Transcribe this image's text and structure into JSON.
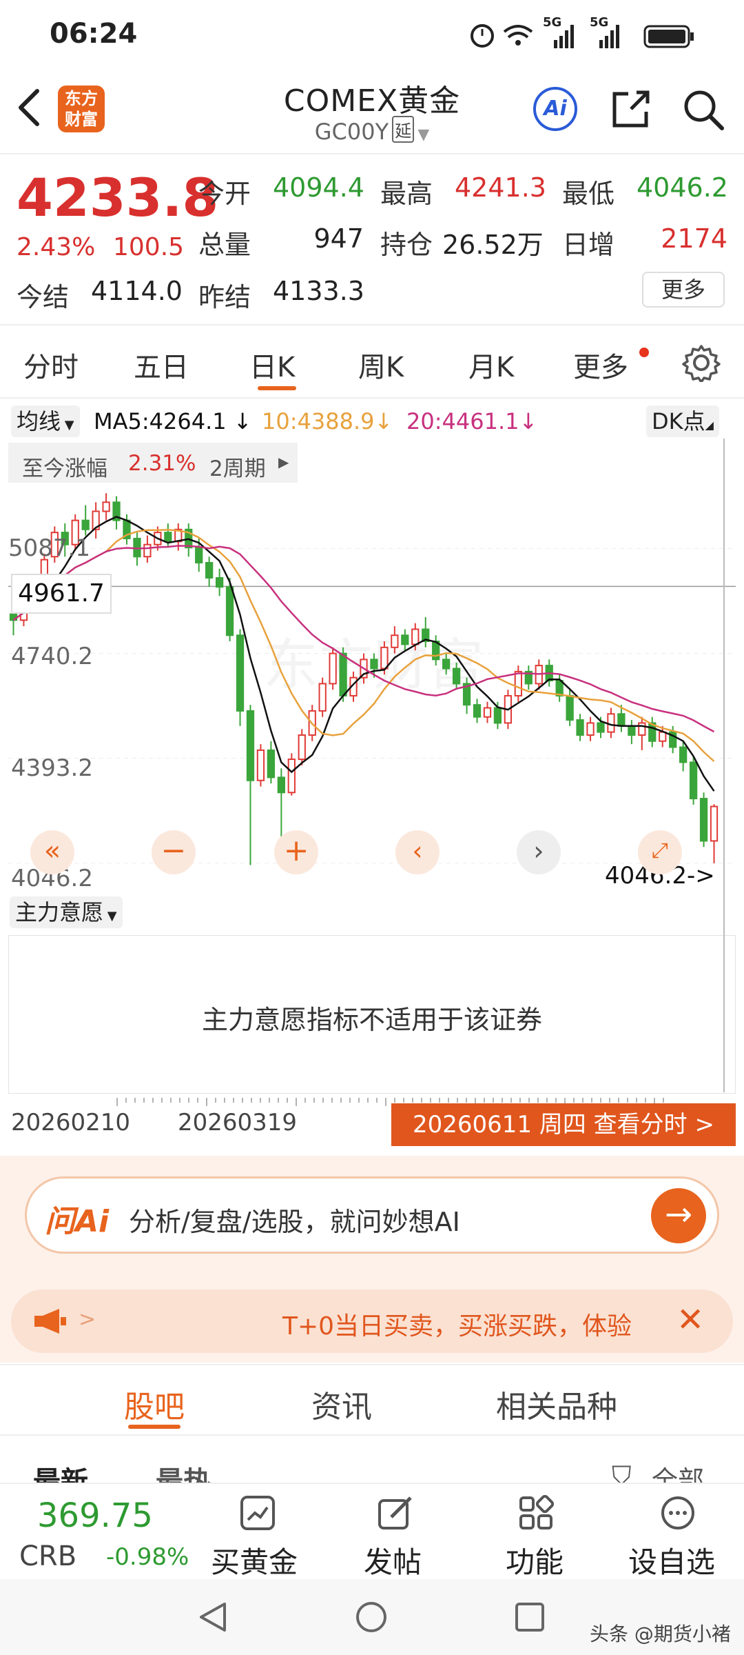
{
  "status_bar": {
    "time": "06:24",
    "signal_label_1": "5G",
    "signal_label_2": "5G"
  },
  "header": {
    "logo_line1": "东方",
    "logo_line2": "财富",
    "title": "COMEX黄金",
    "code": "GC00Y",
    "delay_badge": "延",
    "ai_label": "Ai"
  },
  "quote": {
    "price": "4233.8",
    "change_pct": "2.43%",
    "change_abs": "100.5",
    "open_label": "今开",
    "open": "4094.4",
    "high_label": "最高",
    "high": "4241.3",
    "low_label": "最低",
    "low": "4046.2",
    "volume_label": "总量",
    "volume": "947",
    "oi_label": "持仓",
    "oi": "26.52万",
    "daily_inc_label": "日增",
    "daily_inc": "2174",
    "settle_label": "今结",
    "settle": "4114.0",
    "prev_settle_label": "昨结",
    "prev_settle": "4133.3",
    "more_button": "更多"
  },
  "tabs": [
    {
      "label": "分时"
    },
    {
      "label": "五日"
    },
    {
      "label": "日K"
    },
    {
      "label": "周K"
    },
    {
      "label": "月K"
    },
    {
      "label": "更多"
    }
  ],
  "ma_row": {
    "selector": "均线",
    "ma5": "MA5:4264.1",
    "ma10": "10:4388.9",
    "ma20": "20:4461.1",
    "dk_label": "DK点",
    "arrow": "↓"
  },
  "range_info": {
    "label": "至今涨幅",
    "pct": "2.31%",
    "period": "2周期"
  },
  "chart_data": {
    "type": "candlestick",
    "y_ticks": [
      "5087.1",
      "4740.2",
      "4393.2",
      "4046.2"
    ],
    "ylim": [
      3950,
      5300
    ],
    "crosshair_value": "4961.7",
    "min_marker": "4046.2->",
    "x_ticks": [
      "20260210",
      "20260319"
    ],
    "colors": {
      "up": "#e03a36",
      "down": "#3aa53a",
      "ma5": "#111111",
      "ma10": "#e8a13c",
      "ma20": "#c8307e"
    },
    "candles": [
      [
        4870,
        4850,
        4900,
        4800
      ],
      [
        4850,
        4900,
        4930,
        4830
      ],
      [
        4900,
        4950,
        4980,
        4880
      ],
      [
        4950,
        5050,
        5070,
        4930
      ],
      [
        5060,
        5140,
        5160,
        5040
      ],
      [
        5140,
        5100,
        5170,
        5060
      ],
      [
        5100,
        5180,
        5200,
        5080
      ],
      [
        5180,
        5150,
        5230,
        5130
      ],
      [
        5150,
        5210,
        5240,
        5120
      ],
      [
        5210,
        5240,
        5270,
        5180
      ],
      [
        5240,
        5180,
        5260,
        5150
      ],
      [
        5180,
        5120,
        5200,
        5100
      ],
      [
        5120,
        5060,
        5140,
        5030
      ],
      [
        5060,
        5100,
        5130,
        5040
      ],
      [
        5100,
        5140,
        5160,
        5080
      ],
      [
        5140,
        5110,
        5170,
        5090
      ],
      [
        5110,
        5150,
        5170,
        5080
      ],
      [
        5150,
        5090,
        5170,
        5060
      ],
      [
        5090,
        5040,
        5120,
        5010
      ],
      [
        5040,
        4990,
        5060,
        4960
      ],
      [
        4990,
        4960,
        5020,
        4930
      ],
      [
        4960,
        4800,
        4990,
        4780
      ],
      [
        4800,
        4550,
        4820,
        4500
      ],
      [
        4550,
        4320,
        4570,
        4040
      ],
      [
        4320,
        4420,
        4440,
        4300
      ],
      [
        4420,
        4330,
        4450,
        4310
      ],
      [
        4330,
        4280,
        4360,
        4060
      ],
      [
        4280,
        4390,
        4410,
        4270
      ],
      [
        4390,
        4470,
        4490,
        4370
      ],
      [
        4470,
        4550,
        4570,
        4450
      ],
      [
        4550,
        4640,
        4660,
        4530
      ],
      [
        4640,
        4740,
        4760,
        4620
      ],
      [
        4740,
        4600,
        4760,
        4580
      ],
      [
        4600,
        4660,
        4680,
        4580
      ],
      [
        4660,
        4720,
        4740,
        4640
      ],
      [
        4720,
        4690,
        4740,
        4660
      ],
      [
        4690,
        4760,
        4780,
        4670
      ],
      [
        4760,
        4800,
        4830,
        4740
      ],
      [
        4800,
        4770,
        4820,
        4750
      ],
      [
        4770,
        4820,
        4840,
        4750
      ],
      [
        4820,
        4780,
        4860,
        4760
      ],
      [
        4780,
        4720,
        4800,
        4700
      ],
      [
        4720,
        4690,
        4740,
        4670
      ],
      [
        4690,
        4640,
        4710,
        4620
      ],
      [
        4640,
        4570,
        4660,
        4540
      ],
      [
        4570,
        4530,
        4590,
        4510
      ],
      [
        4530,
        4560,
        4580,
        4510
      ],
      [
        4560,
        4510,
        4580,
        4490
      ],
      [
        4510,
        4600,
        4620,
        4490
      ],
      [
        4600,
        4680,
        4700,
        4580
      ],
      [
        4680,
        4640,
        4700,
        4620
      ],
      [
        4640,
        4700,
        4720,
        4620
      ],
      [
        4700,
        4650,
        4720,
        4630
      ],
      [
        4650,
        4600,
        4670,
        4580
      ],
      [
        4600,
        4520,
        4620,
        4500
      ],
      [
        4520,
        4470,
        4540,
        4450
      ],
      [
        4470,
        4510,
        4530,
        4450
      ],
      [
        4510,
        4480,
        4530,
        4460
      ],
      [
        4480,
        4540,
        4560,
        4460
      ],
      [
        4540,
        4500,
        4570,
        4480
      ],
      [
        4500,
        4470,
        4520,
        4440
      ],
      [
        4470,
        4510,
        4530,
        4420
      ],
      [
        4510,
        4450,
        4530,
        4430
      ],
      [
        4450,
        4480,
        4500,
        4430
      ],
      [
        4480,
        4430,
        4500,
        4410
      ],
      [
        4430,
        4380,
        4450,
        4350
      ],
      [
        4380,
        4260,
        4400,
        4240
      ],
      [
        4260,
        4120,
        4280,
        4100
      ],
      [
        4120,
        4233.8,
        4241.3,
        4046.2
      ]
    ]
  },
  "indicator": {
    "selector": "主力意愿",
    "message": "主力意愿指标不适用于该证券"
  },
  "date_bar": {
    "left_date": "20260210",
    "mid_date": "20260319",
    "cta": "20260611 周四 查看分时 >"
  },
  "ai_bar": {
    "brand": "问Ai",
    "placeholder": "分析/复盘/选股，就问妙想AI"
  },
  "promo": {
    "text": "T+0当日买卖，买涨买跌，体验",
    "arrow": ">"
  },
  "section_tabs": [
    {
      "label": "股吧"
    },
    {
      "label": "资讯"
    },
    {
      "label": "相关品种"
    }
  ],
  "filter_row": {
    "latest": "最新",
    "hot": "最热",
    "all": "全部"
  },
  "bottom_bar": {
    "crb_value": "369.75",
    "crb_label": "CRB",
    "crb_change": "-0.98%",
    "items": [
      {
        "label": "买黄金"
      },
      {
        "label": "发帖"
      },
      {
        "label": "功能"
      },
      {
        "label": "设自选"
      }
    ]
  },
  "watermark": "头条 @期货小褚"
}
